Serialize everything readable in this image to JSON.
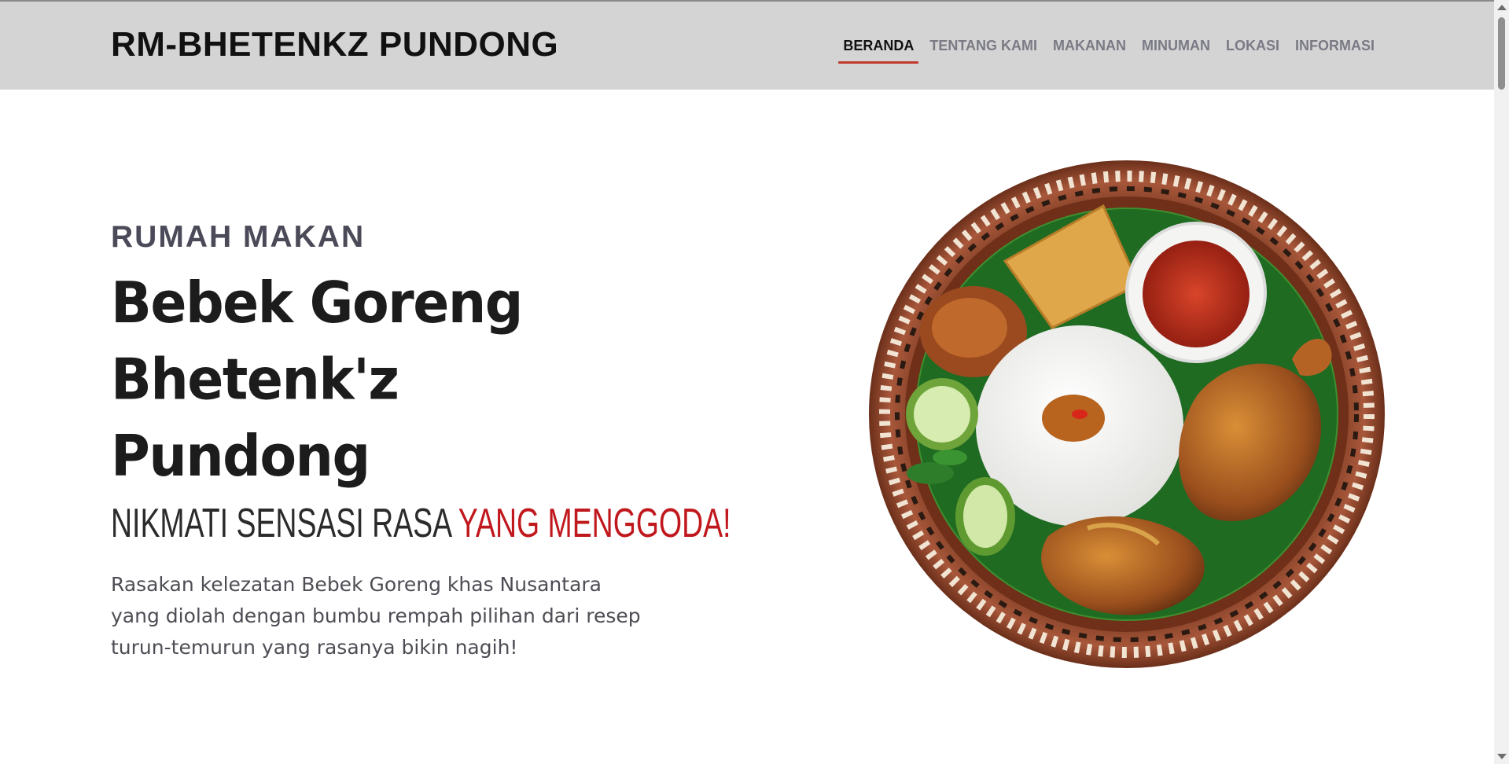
{
  "header": {
    "brand": "RM-BHETENKZ PUNDONG",
    "nav": [
      {
        "label": "BERANDA",
        "active": true
      },
      {
        "label": "TENTANG KAMI",
        "active": false
      },
      {
        "label": "MAKANAN",
        "active": false
      },
      {
        "label": "MINUMAN",
        "active": false
      },
      {
        "label": "LOKASI",
        "active": false
      },
      {
        "label": "INFORMASI",
        "active": false
      }
    ]
  },
  "hero": {
    "eyebrow": "RUMAH MAKAN",
    "title_line1": "Bebek Goreng",
    "title_line2": "Bhetenk'z Pundong",
    "tagline_plain": "NIKMATI SENSASI RASA ",
    "tagline_accent": "YANG MENGGODA!",
    "description": "Rasakan kelezatan Bebek Goreng khas Nusantara yang diolah dengan bumbu rempah pilihan dari resep turun-temurun yang rasanya bikin nagih!",
    "image": "plate of fried duck with rice, sambal, tempeh, cucumber"
  },
  "colors": {
    "navbar_bg": "#d4d4d4",
    "accent_red": "#c0181d",
    "heading": "#1c1c1c",
    "muted": "#4a4a58"
  }
}
